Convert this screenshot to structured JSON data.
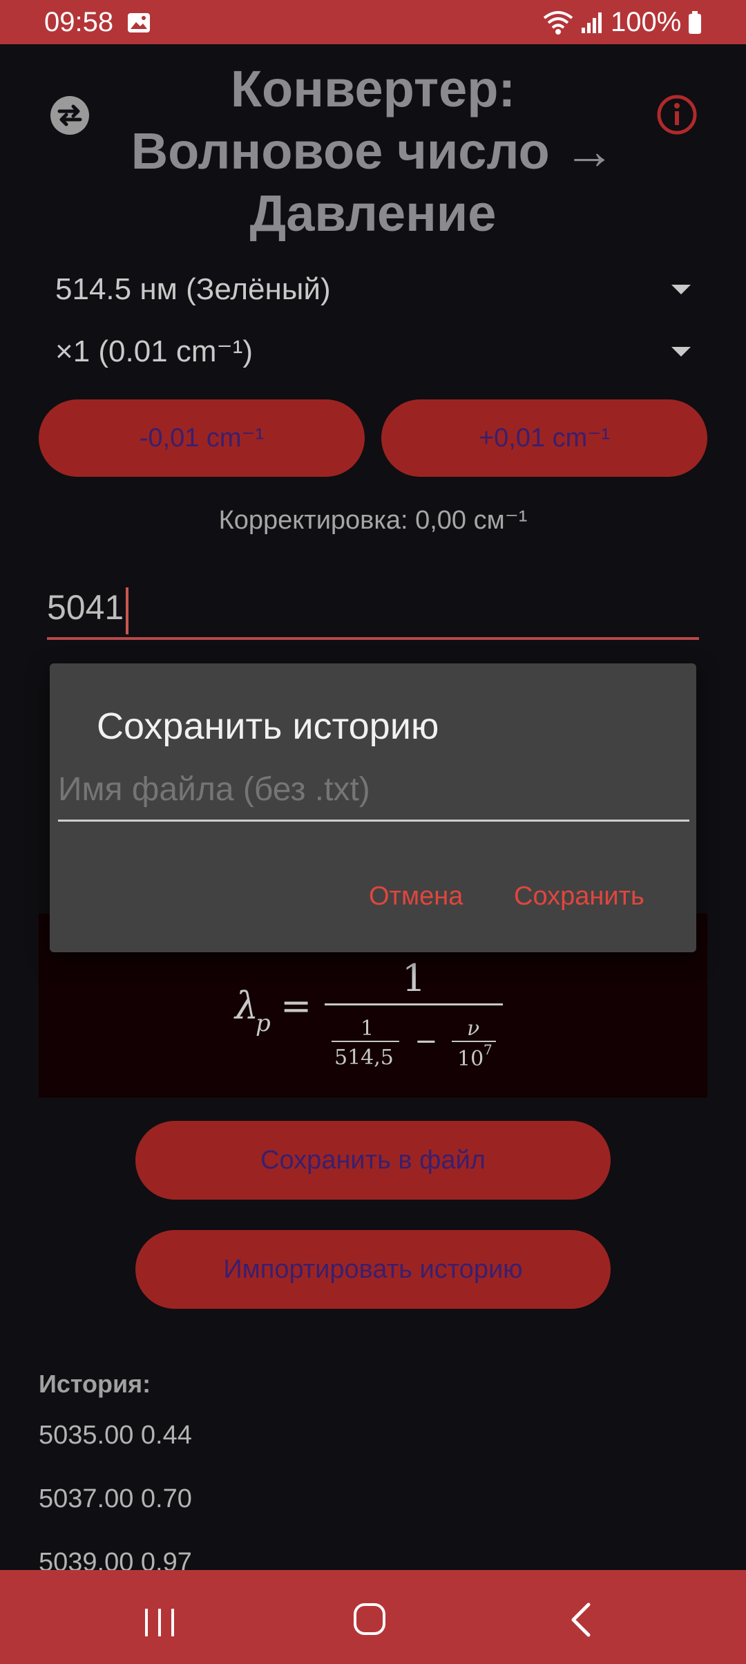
{
  "status_bar": {
    "time": "09:58",
    "battery": "100%"
  },
  "header": {
    "title_line1": "Конвертер:",
    "title_line2": "Волновое число →",
    "title_line3": "Давление",
    "swap_icon": "swap-horizontal-icon",
    "info_icon": "info-icon"
  },
  "selectors": {
    "laser": "514.5 нм (Зелёный)",
    "step": "×1 (0.01 cm⁻¹)"
  },
  "adjust": {
    "minus_label": "-0,01 cm⁻¹",
    "plus_label": "+0,01 cm⁻¹"
  },
  "correction_text": "Корректировка: 0,00 см⁻¹",
  "input": {
    "value": "5041"
  },
  "formula": {
    "lhs": "λ",
    "subscript": "p",
    "numerator": "1",
    "inner_num": "1",
    "inner_den": "514,5",
    "minus": "−",
    "nu": "ν",
    "ten": "10",
    "exp": "7"
  },
  "dialog": {
    "title": "Сохранить историю",
    "placeholder": "Имя файла (без .txt)",
    "cancel": "Отмена",
    "save": "Сохранить"
  },
  "actions": {
    "save_file": "Сохранить в файл",
    "import_history": "Импортировать историю"
  },
  "history": {
    "title": "История:",
    "items": [
      "5035.00 0.44",
      "5037.00 0.70",
      "5039.00 0.97"
    ]
  },
  "colors": {
    "accent": "#b43538",
    "button": "#9b2422",
    "dialog_action": "#e0463e"
  }
}
